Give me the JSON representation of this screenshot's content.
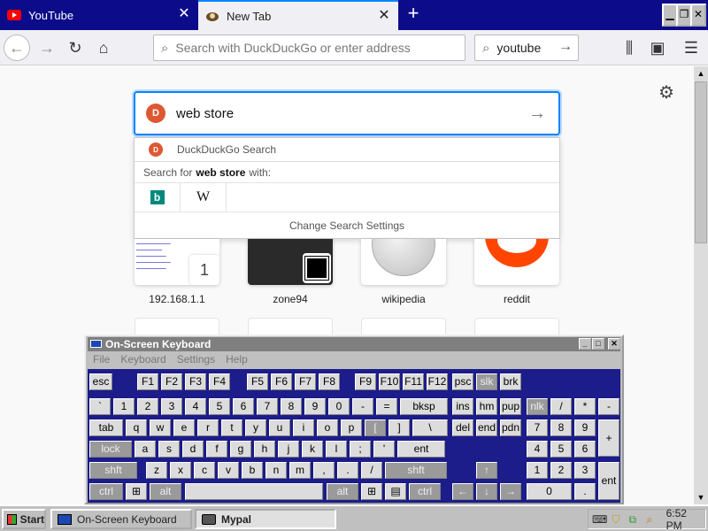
{
  "tabs": [
    {
      "title": "YouTube",
      "icon": "youtube-icon",
      "active": false
    },
    {
      "title": "New Tab",
      "icon": "mypal-icon",
      "active": true
    }
  ],
  "nav": {
    "url_placeholder": "Search with DuckDuckGo or enter address",
    "search_value": "youtube"
  },
  "newtab": {
    "search_query": "web store",
    "suggestions": {
      "engine_name": "DuckDuckGo Search",
      "search_for_prefix": "Search for",
      "search_for_term": "web store",
      "search_for_suffix": "with:",
      "engines": [
        "bing-icon",
        "wikipedia-icon"
      ],
      "wiki_glyph": "W",
      "settings_label": "Change Search Settings"
    },
    "top_sites": [
      {
        "label": "192.168.1.1",
        "badge": "1"
      },
      {
        "label": "zone94"
      },
      {
        "label": "wikipedia"
      },
      {
        "label": "reddit"
      }
    ]
  },
  "osk": {
    "title": "On-Screen Keyboard",
    "menu": [
      "File",
      "Keyboard",
      "Settings",
      "Help"
    ],
    "rows": [
      [
        "esc",
        "F1",
        "F2",
        "F3",
        "F4",
        "F5",
        "F6",
        "F7",
        "F8",
        "F9",
        "F10",
        "F11",
        "F12",
        "psc",
        "slk",
        "brk"
      ],
      [
        "`",
        "1",
        "2",
        "3",
        "4",
        "5",
        "6",
        "7",
        "8",
        "9",
        "0",
        "-",
        "=",
        "bksp",
        "ins",
        "hm",
        "pup",
        "nlk",
        "/",
        "*",
        "-"
      ],
      [
        "tab",
        "q",
        "w",
        "e",
        "r",
        "t",
        "y",
        "u",
        "i",
        "o",
        "p",
        "[",
        "]",
        "\\",
        "del",
        "end",
        "pdn",
        "7",
        "8",
        "9",
        "+"
      ],
      [
        "lock",
        "a",
        "s",
        "d",
        "f",
        "g",
        "h",
        "j",
        "k",
        "l",
        ";",
        "'",
        "ent",
        "4",
        "5",
        "6"
      ],
      [
        "shft",
        "z",
        "x",
        "c",
        "v",
        "b",
        "n",
        "m",
        ",",
        ".",
        "/",
        "shft",
        "↑",
        "1",
        "2",
        "3",
        "ent"
      ],
      [
        "ctrl",
        "⊞",
        "alt",
        "",
        "alt",
        "⊞",
        "▤",
        "ctrl",
        "←",
        "↓",
        "→",
        "0",
        "."
      ]
    ]
  },
  "taskbar": {
    "start_label": "Start",
    "tasks": [
      "On-Screen Keyboard",
      "Mypal"
    ],
    "clock": "6:52 PM"
  }
}
